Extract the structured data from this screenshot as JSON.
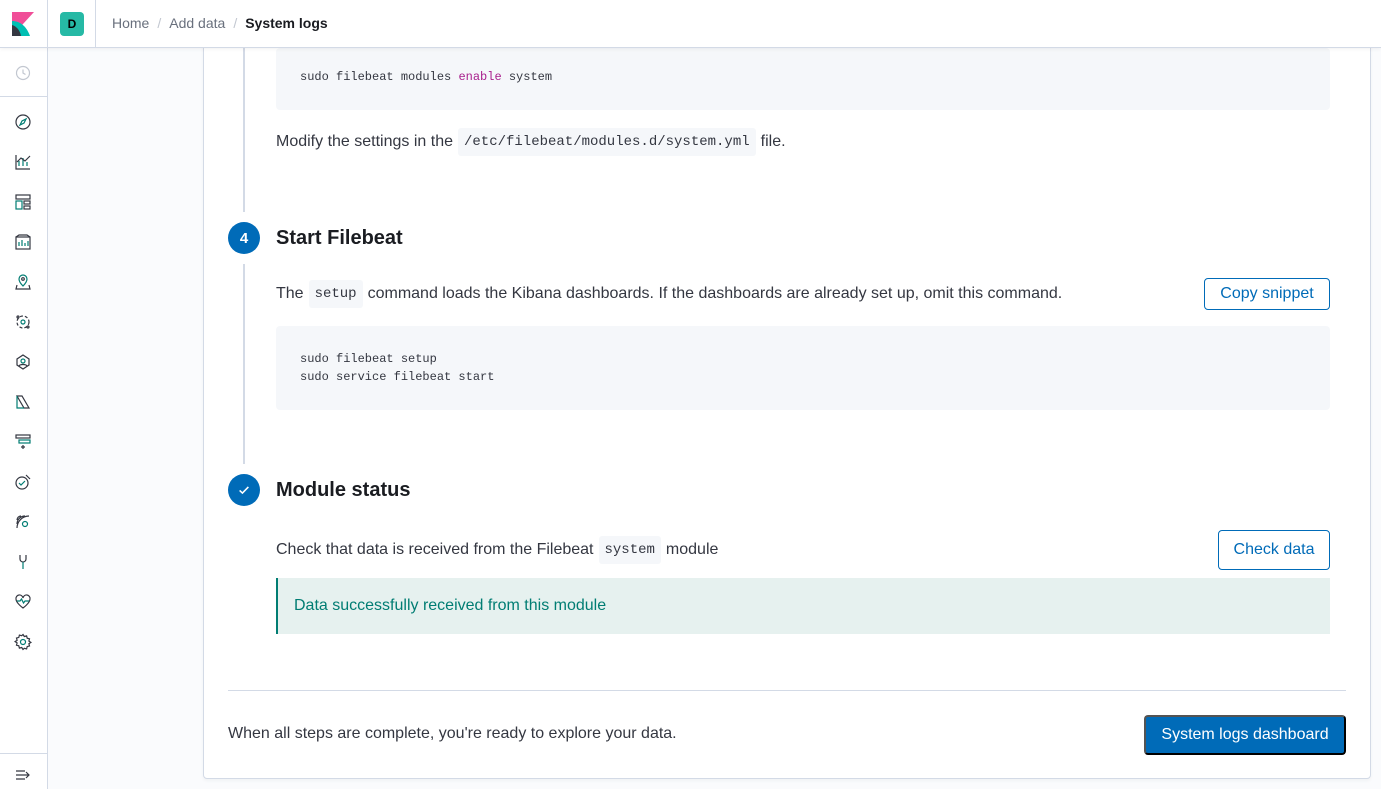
{
  "header": {
    "space_initial": "D",
    "breadcrumbs": [
      "Home",
      "Add data"
    ],
    "breadcrumb_current": "System logs",
    "separator": "/"
  },
  "sidebar": {
    "icons": [
      "recently-viewed-icon",
      "discover-icon",
      "visualize-icon",
      "dashboard-icon",
      "canvas-icon",
      "maps-icon",
      "machine-learning-icon",
      "metrics-icon",
      "logs-icon",
      "apm-icon",
      "uptime-icon",
      "siem-icon",
      "dev-tools-icon",
      "stack-monitoring-icon",
      "management-icon",
      "collapse-icon"
    ]
  },
  "step3": {
    "code_cmd": "sudo filebeat modules ",
    "code_kw": "enable",
    "code_arg": " system",
    "modify_prefix": "Modify the settings in the",
    "modify_path": "/etc/filebeat/modules.d/system.yml",
    "modify_suffix": "file."
  },
  "step4": {
    "number": "4",
    "title": "Start Filebeat",
    "desc_prefix": "The",
    "desc_code": "setup",
    "desc_suffix": "command loads the Kibana dashboards. If the dashboards are already set up, omit this command.",
    "copy_label": "Copy snippet",
    "code_lines": [
      "sudo filebeat setup",
      "sudo service filebeat start"
    ]
  },
  "status": {
    "title": "Module status",
    "desc_prefix": "Check that data is received from the Filebeat",
    "desc_code": "system",
    "desc_suffix": "module",
    "check_label": "Check data",
    "callout": "Data successfully received from this module"
  },
  "footer": {
    "text": "When all steps are complete, you're ready to explore your data.",
    "dashboard_label": "System logs dashboard"
  },
  "colors": {
    "primary": "#006bb8",
    "success": "#017d73",
    "success_bg": "#e6f1ef",
    "keyword": "#a81e8c"
  }
}
